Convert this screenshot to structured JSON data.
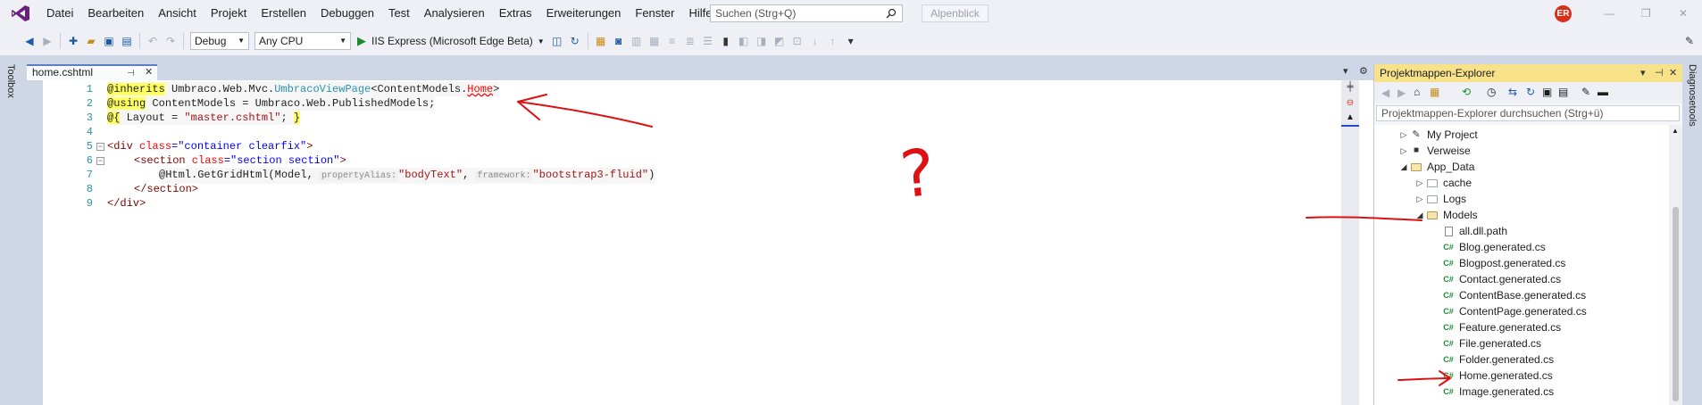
{
  "menu": {
    "items": [
      "Datei",
      "Bearbeiten",
      "Ansicht",
      "Projekt",
      "Erstellen",
      "Debuggen",
      "Test",
      "Analysieren",
      "Extras",
      "Erweiterungen",
      "Fenster",
      "Hilfe"
    ],
    "search_placeholder": "Suchen (Strg+Q)",
    "alpenblick": "Alpenblick",
    "avatar_initials": "ER"
  },
  "toolbar": {
    "config": "Debug",
    "platform": "Any CPU",
    "run_label": "IIS Express (Microsoft Edge Beta)"
  },
  "sidebars": {
    "left": "Toolbox",
    "right": "Diagnosetools"
  },
  "editor": {
    "tab_title": "home.cshtml",
    "lines": {
      "l1_directive": "@inherits",
      "l1_ns": " Umbraco.Web.Mvc.",
      "l1_type": "UmbracoViewPage",
      "l1_lt": "<ContentModels.",
      "l1_home": "Home",
      "l1_gt": ">",
      "l2_directive": "@using",
      "l2_rest": " ContentModels = Umbraco.Web.PublishedModels;",
      "l3_open": "@{",
      "l3_layout": " Layout = ",
      "l3_str": "\"master.cshtml\"",
      "l3_semi": "; ",
      "l3_close": "}",
      "l5_tag": "<div",
      "l5_attr": " class",
      "l5_eq": "=",
      "l5_str": "\"container clearfix\"",
      "l5_end": ">",
      "l6_tag": "<section",
      "l6_attr": " class",
      "l6_eq": "=",
      "l6_str": "\"section section\"",
      "l6_end": ">",
      "l7_call": "@Html.GetGridHtml(Model, ",
      "l7_hint1": "propertyAlias:",
      "l7_str1": "\"bodyText\"",
      "l7_comma": ", ",
      "l7_hint2": "framework:",
      "l7_str2": "\"bootstrap3-fluid\"",
      "l7_end": ")",
      "l8": "</section>",
      "l9": "</div>"
    },
    "line_numbers": [
      "1",
      "2",
      "3",
      "4",
      "5",
      "6",
      "7",
      "8",
      "9"
    ]
  },
  "explorer": {
    "title": "Projektmappen-Explorer",
    "search_placeholder": "Projektmappen-Explorer durchsuchen (Strg+ü)",
    "nodes": [
      {
        "label": "My Project",
        "arrow": "▷",
        "icon": "wrench-icon"
      },
      {
        "label": "Verweise",
        "arrow": "▷",
        "icon": "references-icon"
      },
      {
        "label": "App_Data",
        "arrow": "◢",
        "icon": "folder-icon"
      },
      {
        "label": "cache",
        "arrow": "▷",
        "icon": "folder-icon"
      },
      {
        "label": "Logs",
        "arrow": "▷",
        "icon": "folder-icon"
      },
      {
        "label": "Models",
        "arrow": "◢",
        "icon": "folder-icon"
      },
      {
        "label": "all.dll.path",
        "arrow": "",
        "icon": "file-icon"
      },
      {
        "label": "Blog.generated.cs",
        "arrow": "",
        "icon": "cs-icon"
      },
      {
        "label": "Blogpost.generated.cs",
        "arrow": "",
        "icon": "cs-icon"
      },
      {
        "label": "Contact.generated.cs",
        "arrow": "",
        "icon": "cs-icon"
      },
      {
        "label": "ContentBase.generated.cs",
        "arrow": "",
        "icon": "cs-icon"
      },
      {
        "label": "ContentPage.generated.cs",
        "arrow": "",
        "icon": "cs-icon"
      },
      {
        "label": "Feature.generated.cs",
        "arrow": "",
        "icon": "cs-icon"
      },
      {
        "label": "File.generated.cs",
        "arrow": "",
        "icon": "cs-icon"
      },
      {
        "label": "Folder.generated.cs",
        "arrow": "",
        "icon": "cs-icon"
      },
      {
        "label": "Home.generated.cs",
        "arrow": "",
        "icon": "cs-icon"
      },
      {
        "label": "Image.generated.cs",
        "arrow": "",
        "icon": "cs-icon"
      }
    ]
  },
  "annotations": {
    "question_mark": "?"
  }
}
